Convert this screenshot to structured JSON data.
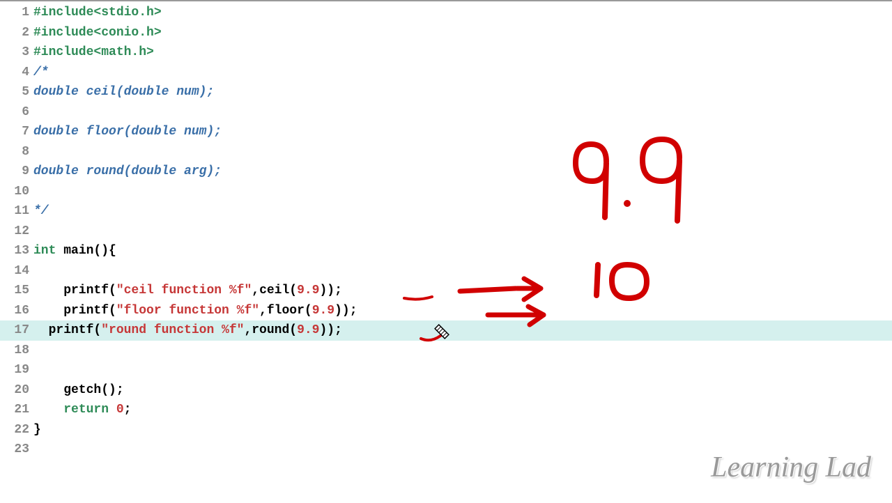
{
  "editor": {
    "highlighted_line": 17,
    "lines": [
      {
        "n": 1,
        "tokens": [
          [
            "tok-inc",
            "#include<stdio.h>"
          ]
        ]
      },
      {
        "n": 2,
        "tokens": [
          [
            "tok-inc",
            "#include<conio.h>"
          ]
        ]
      },
      {
        "n": 3,
        "tokens": [
          [
            "tok-inc",
            "#include<math.h>"
          ]
        ]
      },
      {
        "n": 4,
        "tokens": [
          [
            "tok-com",
            "/*"
          ]
        ]
      },
      {
        "n": 5,
        "tokens": [
          [
            "tok-com",
            "double ceil(double num);"
          ]
        ]
      },
      {
        "n": 6,
        "tokens": [
          [
            "",
            ""
          ]
        ]
      },
      {
        "n": 7,
        "tokens": [
          [
            "tok-com",
            "double floor(double num);"
          ]
        ]
      },
      {
        "n": 8,
        "tokens": [
          [
            "",
            ""
          ]
        ]
      },
      {
        "n": 9,
        "tokens": [
          [
            "tok-com",
            "double round(double arg);"
          ]
        ]
      },
      {
        "n": 10,
        "tokens": [
          [
            "",
            ""
          ]
        ]
      },
      {
        "n": 11,
        "tokens": [
          [
            "tok-com",
            "*/"
          ]
        ]
      },
      {
        "n": 12,
        "tokens": [
          [
            "",
            ""
          ]
        ]
      },
      {
        "n": 13,
        "tokens": [
          [
            "tok-kw",
            "int "
          ],
          [
            "tok-def",
            "main(){"
          ]
        ]
      },
      {
        "n": 14,
        "tokens": [
          [
            "",
            ""
          ]
        ]
      },
      {
        "n": 15,
        "tokens": [
          [
            "",
            "    printf("
          ],
          [
            "tok-str",
            "\"ceil function %f\""
          ],
          [
            "",
            ",ceil("
          ],
          [
            "tok-num",
            "9.9"
          ],
          [
            "",
            "));"
          ]
        ]
      },
      {
        "n": 16,
        "tokens": [
          [
            "",
            "    printf("
          ],
          [
            "tok-str",
            "\"floor function %f\""
          ],
          [
            "",
            ",floor("
          ],
          [
            "tok-num",
            "9.9"
          ],
          [
            "",
            "));"
          ]
        ]
      },
      {
        "n": 17,
        "tokens": [
          [
            "",
            "  printf("
          ],
          [
            "tok-str",
            "\"round function %f\""
          ],
          [
            "",
            ",round("
          ],
          [
            "tok-num",
            "9.9"
          ],
          [
            "",
            "));"
          ]
        ]
      },
      {
        "n": 18,
        "tokens": [
          [
            "",
            ""
          ]
        ]
      },
      {
        "n": 19,
        "tokens": [
          [
            "",
            ""
          ]
        ]
      },
      {
        "n": 20,
        "tokens": [
          [
            "",
            "    getch();"
          ]
        ]
      },
      {
        "n": 21,
        "tokens": [
          [
            "",
            "    "
          ],
          [
            "tok-kw",
            "return "
          ],
          [
            "tok-num",
            "0"
          ],
          [
            "",
            ";"
          ]
        ]
      },
      {
        "n": 22,
        "tokens": [
          [
            "",
            "}"
          ]
        ]
      },
      {
        "n": 23,
        "tokens": [
          [
            "",
            ""
          ]
        ]
      }
    ]
  },
  "annotations": {
    "color": "#d10000",
    "big_number_1": "9.9",
    "big_number_2": "10"
  },
  "watermark": "Learning Lad"
}
